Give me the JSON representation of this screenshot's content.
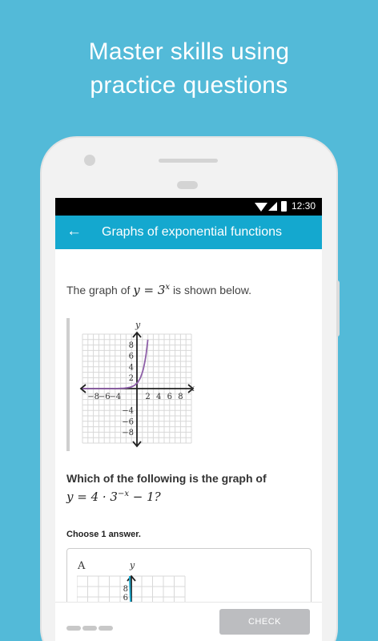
{
  "headline": {
    "line1": "Master skills using",
    "line2": "practice questions"
  },
  "status_bar": {
    "time": "12:30",
    "icons": [
      "wifi-icon",
      "signal-icon",
      "battery-icon"
    ]
  },
  "app_bar": {
    "back_icon": "arrow-left-icon",
    "title": "Graphs of exponential functions"
  },
  "question": {
    "prefix": "The graph of",
    "equation": "y = 3",
    "exponent": "x",
    "suffix": "is shown below."
  },
  "graph": {
    "y_label": "y",
    "x_label": "x",
    "y_ticks": [
      "8",
      "6",
      "4",
      "2",
      "−4",
      "−6",
      "−8"
    ],
    "x_ticks": [
      "−8",
      "−6",
      "−4",
      "2",
      "4",
      "6",
      "8"
    ],
    "curve_color": "#8e5fa8"
  },
  "prompt": {
    "text": "Which of the following is the graph of",
    "equation": "y = 4 · 3",
    "exponent": "−x",
    "tail": " − 1?"
  },
  "choose_label": "Choose 1 answer.",
  "choices": [
    {
      "letter": "A",
      "y_label": "y",
      "y_ticks": [
        "8",
        "6"
      ],
      "curve_color": "#1aa5c9"
    }
  ],
  "bottom_bar": {
    "check_label": "CHECK"
  }
}
